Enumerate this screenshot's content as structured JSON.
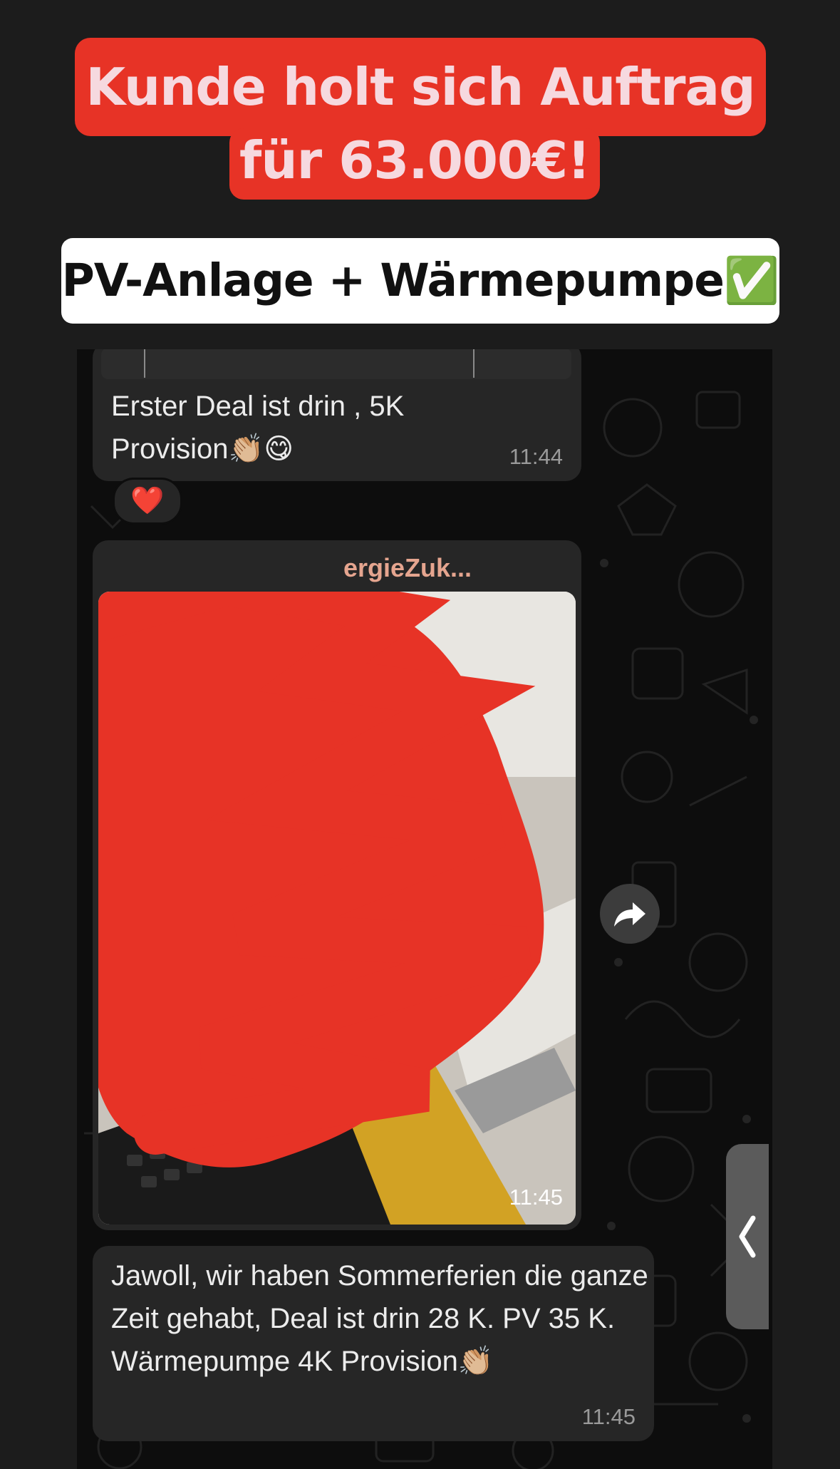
{
  "headline": {
    "line1": "Kunde holt sich Auftrag",
    "line2": "für 63.000€!"
  },
  "subtitle": "PV-Anlage + Wärmepumpe✅",
  "messages": [
    {
      "text": "Erster Deal ist drin , 5K Provision👏🏼😋",
      "time": "11:44",
      "reaction": "❤️"
    },
    {
      "sender": "ergieZuk...",
      "time": "11:45"
    },
    {
      "text": "Jawoll, wir haben Sommerferien die ganze Zeit gehabt, Deal ist drin 28 K. PV 35 K. Wärmepumpe 4K Provision👏🏼",
      "time": "11:45"
    }
  ],
  "colors": {
    "banner_red": "#e73326",
    "bubble": "#262626",
    "sender_name": "#e5a58f"
  },
  "icons": {
    "forward": "forward-arrow-icon",
    "side_tab": "chevron-left-icon"
  }
}
